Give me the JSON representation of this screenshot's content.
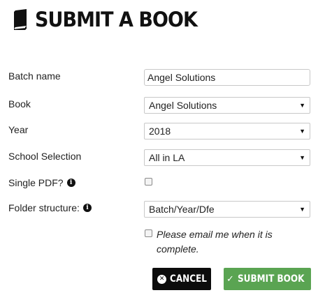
{
  "page": {
    "title": "SUBMIT A BOOK",
    "title_icon": "book-icon"
  },
  "form": {
    "batch_name": {
      "label": "Batch name",
      "value": "Angel Solutions"
    },
    "book": {
      "label": "Book",
      "selected": "Angel Solutions"
    },
    "year": {
      "label": "Year",
      "selected": "2018"
    },
    "school_selection": {
      "label": "School Selection",
      "selected": "All in LA"
    },
    "single_pdf": {
      "label": "Single PDF?",
      "info_icon": "info-icon",
      "checked": false
    },
    "folder_structure": {
      "label": "Folder structure:",
      "info_icon": "info-icon",
      "selected": "Batch/Year/Dfe"
    },
    "email_me": {
      "label": "Please email me when it is complete.",
      "checked": false
    }
  },
  "buttons": {
    "cancel": {
      "label": "CANCEL",
      "icon": "cancel-circle-icon",
      "color": "#0c0c0c"
    },
    "submit": {
      "label": "SUBMIT BOOK",
      "icon": "check-icon",
      "color": "#5aa452"
    }
  }
}
